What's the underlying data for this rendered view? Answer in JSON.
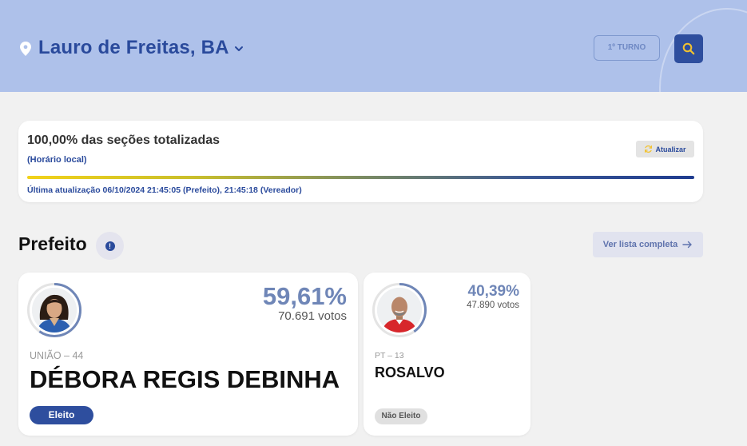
{
  "header": {
    "city": "Lauro de Freitas, BA",
    "turno_label": "1º TURNO",
    "icons": {
      "location": "location-pin-icon",
      "dropdown": "chevron-down-icon",
      "search": "search-icon"
    },
    "colors": {
      "background": "#aec1ea",
      "accent": "#2e4e9e",
      "search_icon": "#f2c230"
    }
  },
  "status": {
    "title": "100,00% das seções totalizadas",
    "subtitle": "(Horário local)",
    "refresh_label": "Atualizar",
    "progress_fraction": 1.0,
    "last_update": "Última atualização 06/10/2024 21:45:05 (Prefeito), 21:45:18 (Vereador)"
  },
  "section": {
    "title": "Prefeito",
    "info_icon": "info-icon",
    "list_button_label": "Ver lista completa",
    "list_button_icon": "arrow-right-icon"
  },
  "candidates": [
    {
      "percent": "59,61%",
      "votes": "70.691 votos",
      "vote_share": 0.5961,
      "party": "UNIÃO – 44",
      "name": "DÉBORA REGIS DEBINHA",
      "status": "Eleito"
    },
    {
      "percent": "40,39%",
      "votes": "47.890 votos",
      "vote_share": 0.4039,
      "party": "PT – 13",
      "name": "ROSALVO",
      "status": "Não Eleito"
    }
  ]
}
